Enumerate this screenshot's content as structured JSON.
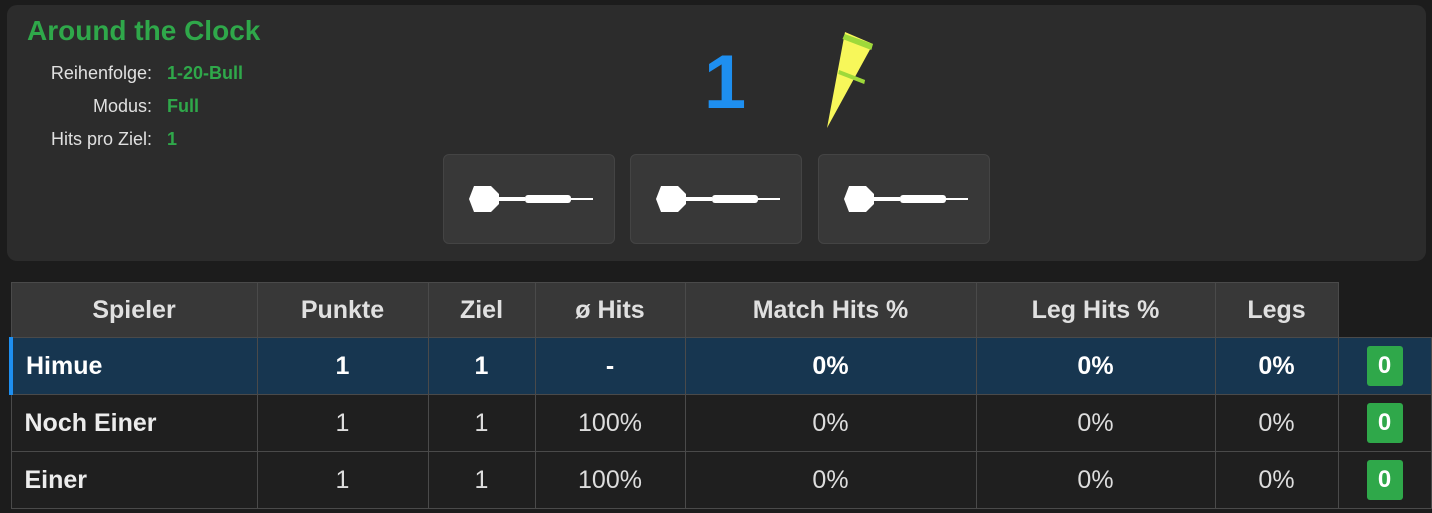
{
  "game": {
    "title": "Around the Clock",
    "settings": [
      {
        "label": "Reihenfolge:",
        "value": "1-20-Bull"
      },
      {
        "label": "Modus:",
        "value": "Full"
      },
      {
        "label": "Hits pro Ziel:",
        "value": "1"
      }
    ]
  },
  "current_target": {
    "number": "1",
    "segment_icon": "dartboard-segment-icon"
  },
  "dart_slots": [
    {
      "icon": "dart-icon"
    },
    {
      "icon": "dart-icon"
    },
    {
      "icon": "dart-icon"
    }
  ],
  "table": {
    "headers": [
      "Spieler",
      "Punkte",
      "Ziel",
      "ø Hits",
      "Match Hits %",
      "Leg Hits %",
      "Legs"
    ],
    "rows": [
      {
        "name": "Himue",
        "punkte": "1",
        "ziel": "1",
        "hits": "-",
        "match_hits": "0%",
        "leg_hits": "0%",
        "legs": "0%",
        "legs_won": "0",
        "active": true
      },
      {
        "name": "Noch Einer",
        "punkte": "1",
        "ziel": "1",
        "hits": "100%",
        "match_hits": "0%",
        "leg_hits": "0%",
        "legs": "0%",
        "legs_won": "0",
        "active": false
      },
      {
        "name": "Einer",
        "punkte": "1",
        "ziel": "1",
        "hits": "100%",
        "match_hits": "0%",
        "leg_hits": "0%",
        "legs": "0%",
        "legs_won": "0",
        "active": false
      }
    ]
  },
  "colors": {
    "accent_green": "#2fa84a",
    "accent_blue": "#1e8ff0",
    "active_row": "#173650",
    "segment_yellow": "#f7f75a",
    "segment_green": "#9ed93a"
  }
}
